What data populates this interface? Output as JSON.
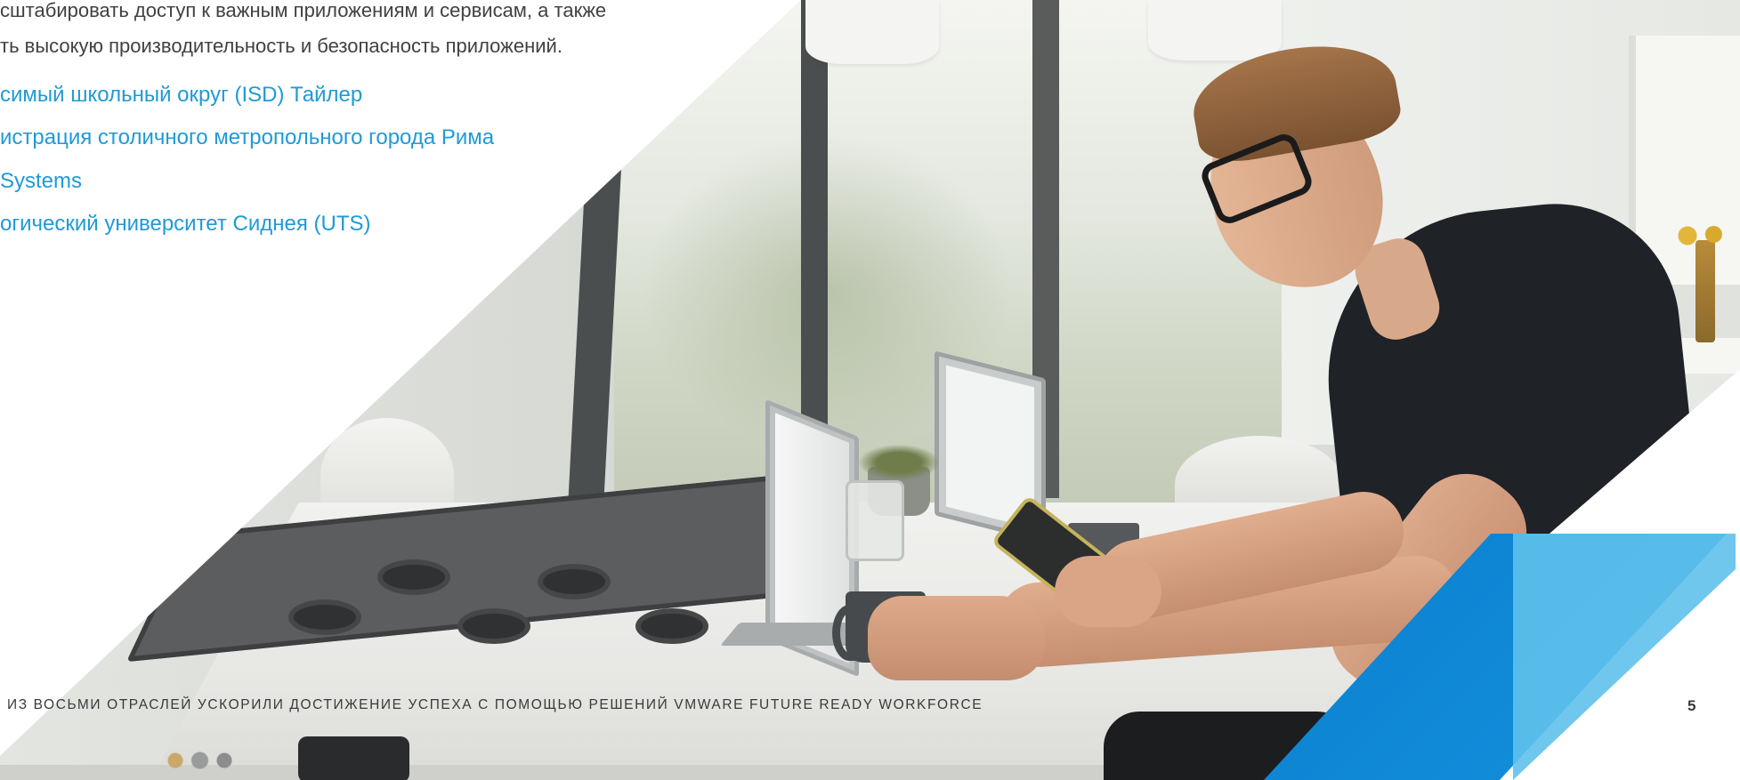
{
  "body": {
    "line1": "сштабировать доступ к важным приложениям и сервисам, а также",
    "line2": "ть высокую производительность и безопасность приложений."
  },
  "customer_links": [
    "симый школьный округ (ISD) Тайлер",
    "истрация столичного метропольного города Рима",
    " Systems",
    "огический университет Сиднея (UTS)"
  ],
  "footer": {
    "text": "ИЗ ВОСЬМИ ОТРАСЛЕЙ УСКОРИЛИ ДОСТИЖЕНИЕ УСПЕХА С ПОМОЩЬЮ РЕШЕНИЙ VMWARE FUTURE READY WORKFORCE",
    "page_number": "5"
  },
  "colors": {
    "body_text": "#414042",
    "link": "#1f9ad6",
    "accent_dark_blue": "#0a7fcf",
    "accent_light_blue": "#5fc1ec"
  }
}
